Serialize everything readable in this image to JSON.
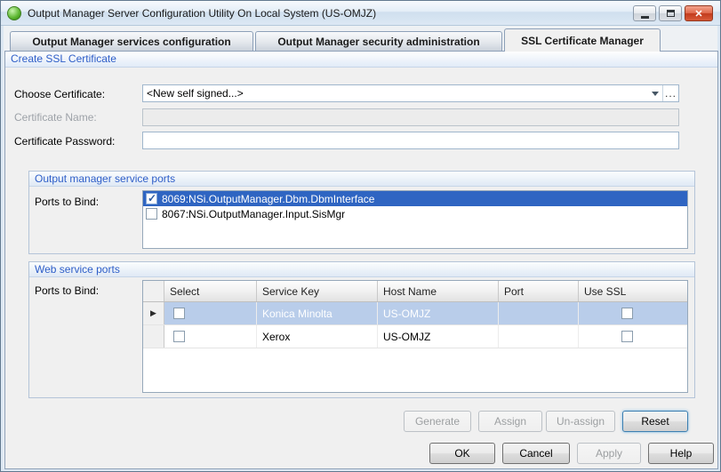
{
  "window": {
    "title": "Output Manager Server Configuration Utility On Local System (US-OMJZ)"
  },
  "tabs": [
    {
      "label": "Output Manager services configuration",
      "active": false
    },
    {
      "label": "Output Manager security administration",
      "active": false
    },
    {
      "label": "SSL Certificate Manager",
      "active": true
    }
  ],
  "create_ssl": {
    "header": "Create SSL Certificate",
    "choose_certificate_label": "Choose Certificate:",
    "choose_certificate_value": "<New self signed...>",
    "browse_label": "...",
    "certificate_name_label": "Certificate Name:",
    "certificate_name_value": "",
    "certificate_password_label": "Certificate Password:",
    "certificate_password_value": ""
  },
  "service_ports": {
    "header": "Output manager service ports",
    "ports_label": "Ports to Bind:",
    "items": [
      {
        "label": "8069:NSi.OutputManager.Dbm.DbmInterface",
        "checked": true,
        "selected": true
      },
      {
        "label": "8067:NSi.OutputManager.Input.SisMgr",
        "checked": false,
        "selected": false
      }
    ]
  },
  "web_ports": {
    "header": "Web service ports",
    "ports_label": "Ports to Bind:",
    "columns": {
      "select": "Select",
      "service_key": "Service Key",
      "host_name": "Host Name",
      "port": "Port",
      "use_ssl": "Use SSL"
    },
    "rows": [
      {
        "select_checked": false,
        "service_key": "Konica Minolta",
        "host_name": "US-OMJZ",
        "port": "",
        "use_ssl_checked": false,
        "selected": true
      },
      {
        "select_checked": false,
        "service_key": "Xerox",
        "host_name": "US-OMJZ",
        "port": "",
        "use_ssl_checked": false,
        "selected": false
      }
    ]
  },
  "actions": {
    "generate": {
      "label": "Generate",
      "disabled": true
    },
    "assign": {
      "label": "Assign",
      "disabled": true
    },
    "unassign": {
      "label": "Un-assign",
      "disabled": true
    },
    "reset": {
      "label": "Reset",
      "disabled": false
    }
  },
  "dialog": {
    "ok": {
      "label": "OK",
      "disabled": false
    },
    "cancel": {
      "label": "Cancel",
      "disabled": false
    },
    "apply": {
      "label": "Apply",
      "disabled": true
    },
    "help": {
      "label": "Help",
      "disabled": false
    }
  }
}
